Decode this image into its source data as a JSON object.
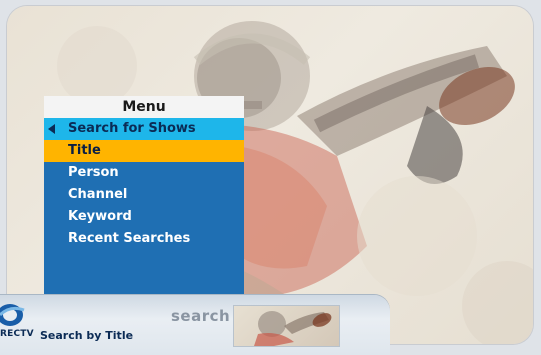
{
  "menu": {
    "header": "Menu",
    "active_section": "Search for Shows",
    "items": [
      {
        "label": "Title",
        "selected": true
      },
      {
        "label": "Person",
        "selected": false
      },
      {
        "label": "Channel",
        "selected": false
      },
      {
        "label": "Keyword",
        "selected": false
      },
      {
        "label": "Recent Searches",
        "selected": false
      }
    ]
  },
  "footer": {
    "logo_text": "RECTV",
    "section_title": "Search by Title",
    "mode_label": "search"
  },
  "colors": {
    "menu_blue": "#1f6fb3",
    "section_cyan": "#1eb6ea",
    "selected_yellow": "#ffb400"
  },
  "icons": {
    "back": "back-arrow-icon",
    "logo": "directv-logo-icon"
  }
}
